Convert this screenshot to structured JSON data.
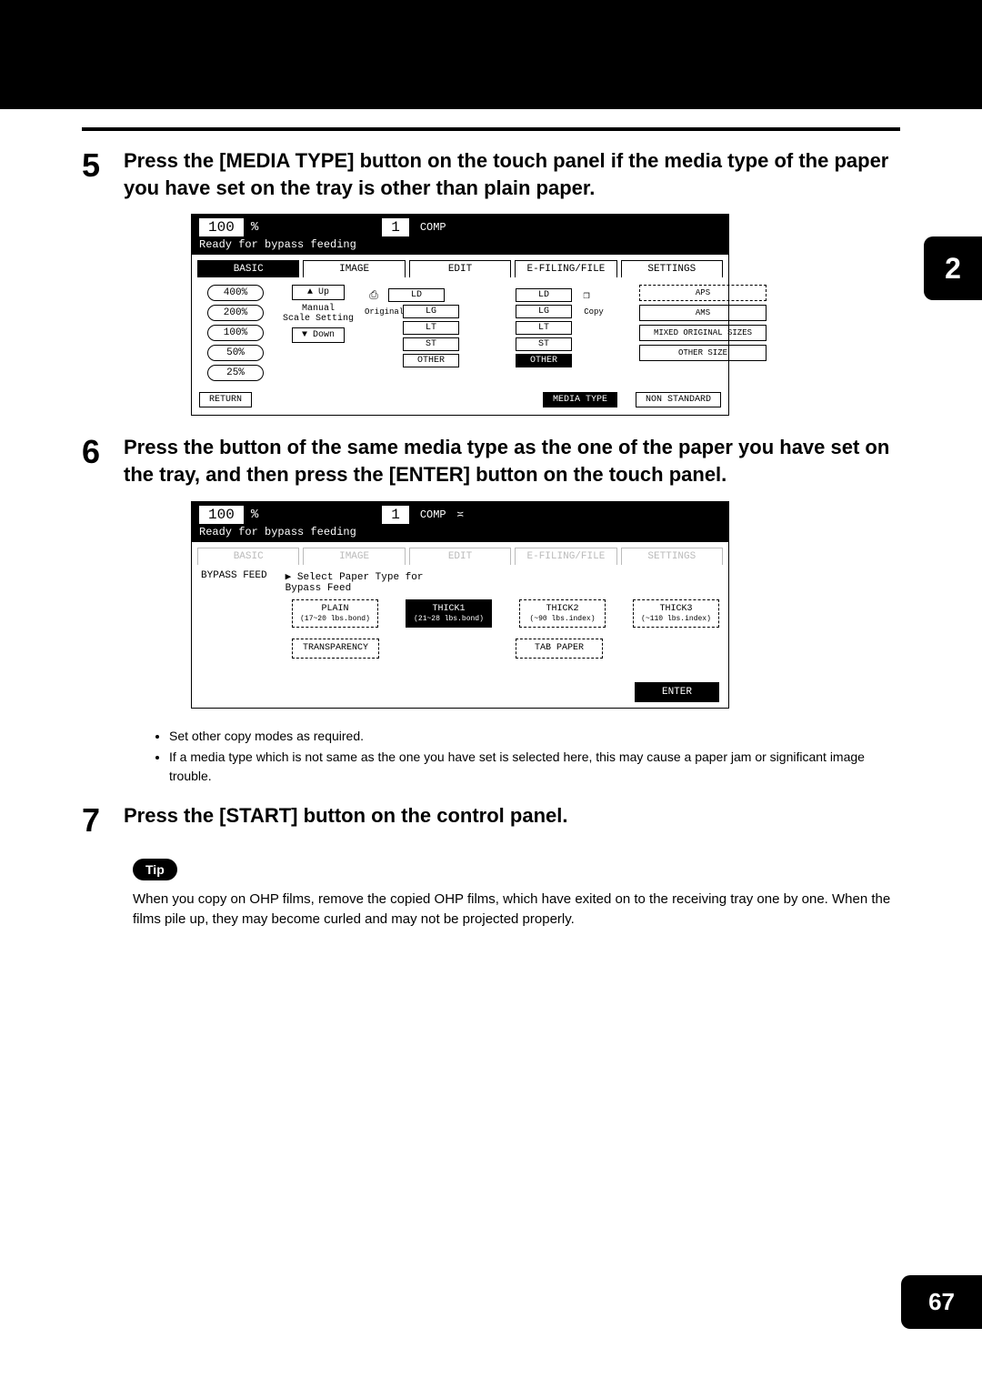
{
  "side_tab": "2",
  "page_number": "67",
  "steps": {
    "s5": {
      "num": "5",
      "text": "Press the [MEDIA TYPE] button on the touch panel if the media type of the paper you have set on the tray is other than plain paper."
    },
    "s6": {
      "num": "6",
      "text": "Press the button of the same media type as the one of the paper you have set on the tray, and then press the [ENTER] button on the touch panel."
    },
    "s7": {
      "num": "7",
      "text": "Press the [START] button on the control panel."
    }
  },
  "panel_common": {
    "value": "100",
    "pct": "%",
    "count": "1",
    "mode": "COMP",
    "status": "Ready for bypass feeding",
    "tabs": {
      "basic": "BASIC",
      "image": "IMAGE",
      "edit": "EDIT",
      "efiling": "E-FILING/FILE",
      "settings": "SETTINGS"
    }
  },
  "panel1": {
    "zoom": [
      "400%",
      "200%",
      "100%",
      "50%",
      "25%"
    ],
    "up": "▲  Up",
    "down": "▼  Down",
    "manual1": "Manual",
    "manual2": "Scale Setting",
    "original": "Original",
    "copy": "Copy",
    "sizes_left": [
      "LD",
      "LG",
      "LT",
      "ST",
      "OTHER"
    ],
    "sizes_right": [
      "LD",
      "LG",
      "LT",
      "ST",
      "OTHER"
    ],
    "right": {
      "aps": "APS",
      "ams": "AMS",
      "mixed": "MIXED ORIGINAL SIZES",
      "other": "OTHER SIZE"
    },
    "footer": {
      "return": "RETURN",
      "media": "MEDIA TYPE",
      "nonstd": "NON STANDARD"
    }
  },
  "panel2": {
    "bypass": "BYPASS FEED",
    "prompt": "Select Paper Type for\nBypass Feed",
    "plain": "PLAIN",
    "plain_sub": "(17~20 lbs.bond)",
    "thick1": "THICK1",
    "thick1_sub": "(21~28 lbs.bond)",
    "thick2": "THICK2",
    "thick2_sub": "(~90 lbs.index)",
    "thick3": "THICK3",
    "thick3_sub": "(~110 lbs.index)",
    "transparency": "TRANSPARENCY",
    "tab": "TAB PAPER",
    "enter": "ENTER"
  },
  "bullets": {
    "b1": "Set other copy modes as required.",
    "b2": "If a media type which is not same as the one you have set is selected here, this may cause a paper jam or significant image trouble."
  },
  "tip": {
    "label": "Tip",
    "text": "When you copy on OHP films, remove the copied OHP films, which have exited on to the receiving tray one by one. When the films pile up, they may become curled and may not be projected properly."
  }
}
